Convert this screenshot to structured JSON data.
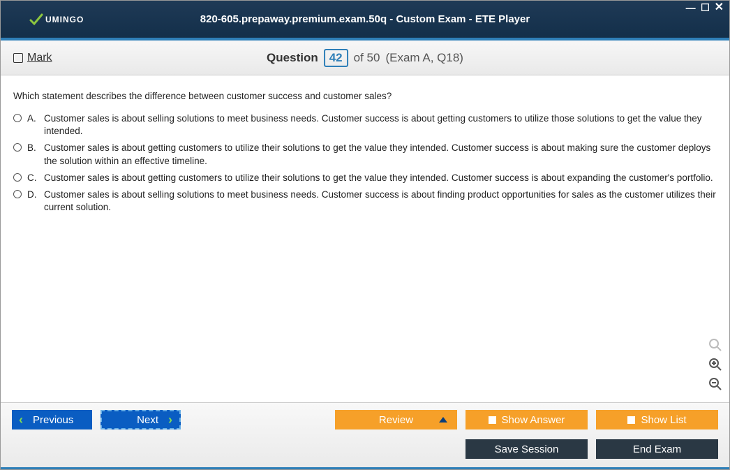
{
  "titlebar": {
    "logo_text": "UMINGO",
    "title": "820-605.prepaway.premium.exam.50q - Custom Exam - ETE Player"
  },
  "toolbar": {
    "mark_label": "Mark",
    "question_word": "Question",
    "current_num": "42",
    "of_total": "of 50",
    "exam_ref": "(Exam A, Q18)"
  },
  "question": {
    "text": "Which statement describes the difference between customer success and customer sales?",
    "options": [
      {
        "letter": "A.",
        "text": "Customer sales is about selling solutions to meet business needs. Customer success is about getting customers to utilize those solutions to get the value they intended."
      },
      {
        "letter": "B.",
        "text": "Customer sales is about getting customers to utilize their solutions to get the value they intended. Customer success is about making sure the customer deploys the solution within an effective timeline."
      },
      {
        "letter": "C.",
        "text": "Customer sales is about getting customers to utilize their solutions to get the value they intended. Customer success is about expanding the customer's portfolio."
      },
      {
        "letter": "D.",
        "text": "Customer sales is about selling solutions to meet business needs. Customer success is about finding product opportunities for sales as the customer utilizes their current solution."
      }
    ]
  },
  "footer": {
    "previous": "Previous",
    "next": "Next",
    "review": "Review",
    "show_answer": "Show Answer",
    "show_list": "Show List",
    "save_session": "Save Session",
    "end_exam": "End Exam"
  }
}
